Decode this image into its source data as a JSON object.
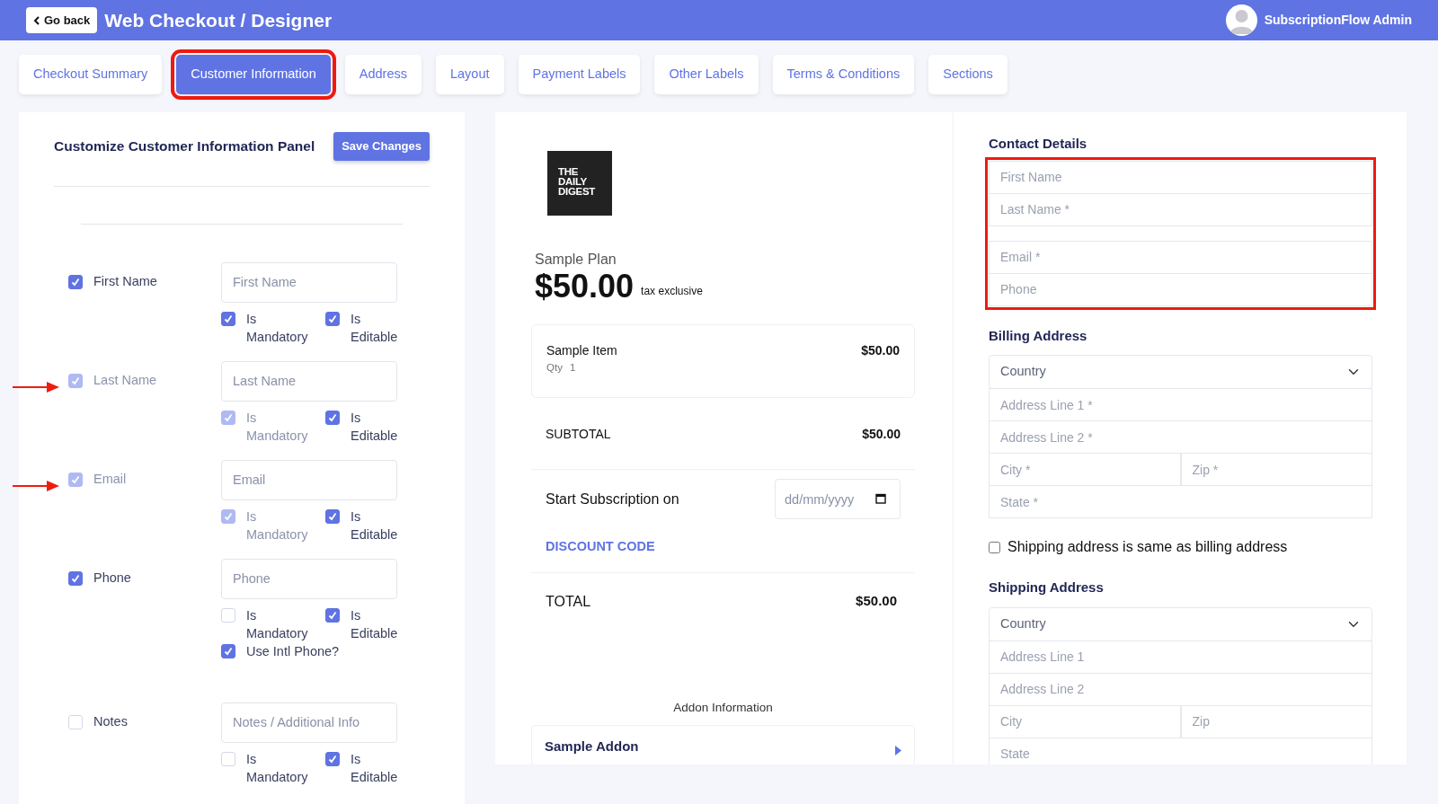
{
  "header": {
    "back_button": "Go back",
    "title": "Web Checkout / Designer",
    "user_name": "SubscriptionFlow Admin"
  },
  "tabs": [
    {
      "label": "Checkout Summary",
      "selected": false,
      "highlighted": false
    },
    {
      "label": "Customer Information",
      "selected": true,
      "highlighted": true
    },
    {
      "label": "Address",
      "selected": false,
      "highlighted": false
    },
    {
      "label": "Layout",
      "selected": false,
      "highlighted": false
    },
    {
      "label": "Payment Labels",
      "selected": false,
      "highlighted": false
    },
    {
      "label": "Other Labels",
      "selected": false,
      "highlighted": false
    },
    {
      "label": "Terms & Conditions",
      "selected": false,
      "highlighted": false
    },
    {
      "label": "Sections",
      "selected": false,
      "highlighted": false
    }
  ],
  "editor": {
    "title": "Customize Customer Information Panel",
    "save_button": "Save Changes",
    "fields": [
      {
        "label": "First Name",
        "checked": true,
        "disabled": false,
        "arrow": false,
        "placeholder": "First Name",
        "options": [
          {
            "label": "Is Mandatory",
            "checked": true,
            "disabled": false
          },
          {
            "label": "Is Editable",
            "checked": true,
            "disabled": false
          }
        ]
      },
      {
        "label": "Last Name",
        "checked": true,
        "disabled": true,
        "arrow": true,
        "placeholder": "Last Name",
        "options": [
          {
            "label": "Is Mandatory",
            "checked": true,
            "disabled": true
          },
          {
            "label": "Is Editable",
            "checked": true,
            "disabled": false
          }
        ]
      },
      {
        "label": "Email",
        "checked": true,
        "disabled": true,
        "arrow": true,
        "placeholder": "Email",
        "options": [
          {
            "label": "Is Mandatory",
            "checked": true,
            "disabled": true
          },
          {
            "label": "Is Editable",
            "checked": true,
            "disabled": false
          }
        ]
      },
      {
        "label": "Phone",
        "checked": true,
        "disabled": false,
        "arrow": false,
        "placeholder": "Phone",
        "options": [
          {
            "label": "Is Mandatory",
            "checked": false,
            "disabled": false
          },
          {
            "label": "Is Editable",
            "checked": true,
            "disabled": false
          }
        ],
        "extra": {
          "label": "Use Intl Phone?",
          "checked": true
        }
      },
      {
        "label": "Notes",
        "checked": false,
        "disabled": false,
        "arrow": false,
        "placeholder": "Notes / Additional Info",
        "options": [
          {
            "label": "Is Mandatory",
            "checked": false,
            "disabled": false
          },
          {
            "label": "Is Editable",
            "checked": true,
            "disabled": false
          }
        ]
      }
    ]
  },
  "preview": {
    "logo": "THE DAILY DIGEST",
    "plan_name": "Sample Plan",
    "price": "$50.00",
    "price_note": "tax exclusive",
    "item": {
      "name": "Sample Item",
      "qty_label": "Qty",
      "qty": "1",
      "amount": "$50.00"
    },
    "subtotal_label": "SUBTOTAL",
    "subtotal": "$50.00",
    "start_label": "Start Subscription on",
    "date_placeholder": "dd/mm/yyyy",
    "discount_link": "DISCOUNT CODE",
    "total_label": "TOTAL",
    "total": "$50.00",
    "addon_heading": "Addon Information",
    "addon_name": "Sample Addon"
  },
  "form": {
    "contact": {
      "title": "Contact Details",
      "highlighted": true,
      "groups": [
        [
          {
            "placeholder": "First Name"
          },
          {
            "placeholder": "Last Name *"
          }
        ],
        [
          {
            "placeholder": "Email *"
          },
          {
            "placeholder": "Phone"
          }
        ]
      ]
    },
    "billing": {
      "title": "Billing Address",
      "rows": [
        {
          "kind": "select",
          "placeholders": [
            "Country"
          ]
        },
        {
          "kind": "input",
          "placeholders": [
            "Address Line 1 *"
          ]
        },
        {
          "kind": "input",
          "placeholders": [
            "Address Line 2 *"
          ]
        },
        {
          "kind": "input",
          "placeholders": [
            "City *",
            "Zip *"
          ]
        },
        {
          "kind": "input",
          "placeholders": [
            "State *"
          ]
        }
      ]
    },
    "same_as_billing": {
      "label": "Shipping address is same as billing address",
      "checked": false
    },
    "shipping": {
      "title": "Shipping Address",
      "rows": [
        {
          "kind": "select",
          "placeholders": [
            "Country"
          ]
        },
        {
          "kind": "input",
          "placeholders": [
            "Address Line 1"
          ]
        },
        {
          "kind": "input",
          "placeholders": [
            "Address Line 2"
          ]
        },
        {
          "kind": "input",
          "placeholders": [
            "City",
            "Zip"
          ]
        },
        {
          "kind": "input",
          "placeholders": [
            "State"
          ]
        }
      ]
    }
  }
}
